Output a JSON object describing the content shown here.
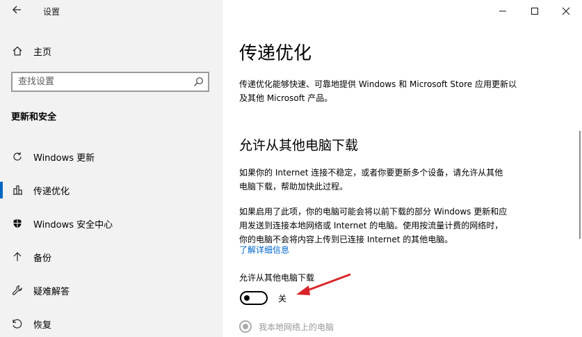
{
  "window": {
    "app_title": "设置"
  },
  "sidebar": {
    "home_label": "主页",
    "search": {
      "placeholder": "查找设置",
      "value": ""
    },
    "section_heading": "更新和安全",
    "items": [
      {
        "label": "Windows 更新",
        "icon": "refresh-icon",
        "active": false
      },
      {
        "label": "传递优化",
        "icon": "delivery-optimization-icon",
        "active": true
      },
      {
        "label": "Windows 安全中心",
        "icon": "shield-icon",
        "active": false
      },
      {
        "label": "备份",
        "icon": "backup-arrow-icon",
        "active": false
      },
      {
        "label": "疑难解答",
        "icon": "wrench-icon",
        "active": false
      },
      {
        "label": "恢复",
        "icon": "recovery-icon",
        "active": false
      }
    ]
  },
  "main": {
    "title": "传递优化",
    "intro_line1": "传递优化能够快速、可靠地提供 Windows 和 Microsoft Store 应用更新以",
    "intro_line2": "及其他 Microsoft 产品。",
    "subtitle": "允许从其他电脑下载",
    "para1_line1": "如果你的 Internet 连接不稳定，或者你要更新多个设备，请允许从其他",
    "para1_line2": "电脑下载，帮助加快此过程。",
    "para2_line1": "如果启用了此项，你的电脑可能会将以前下载的部分 Windows 更新和应",
    "para2_line2": "用发送到连接本地网络或 Internet 的电脑。使用按流量计费的网络时，",
    "para2_line3": "你的电脑不会将内容上传到已连接 Internet 的其他电脑。",
    "learn_more": "了解详细信息",
    "toggle_label": "允许从其他电脑下载",
    "toggle_state": "关",
    "toggle_on": false,
    "radio_label": "我本地网络上的电脑"
  },
  "colors": {
    "accent": "#0067c0",
    "link": "#0066cc",
    "sidebar_bg": "#f2f2f2",
    "annotation_arrow": "#d9252a"
  }
}
